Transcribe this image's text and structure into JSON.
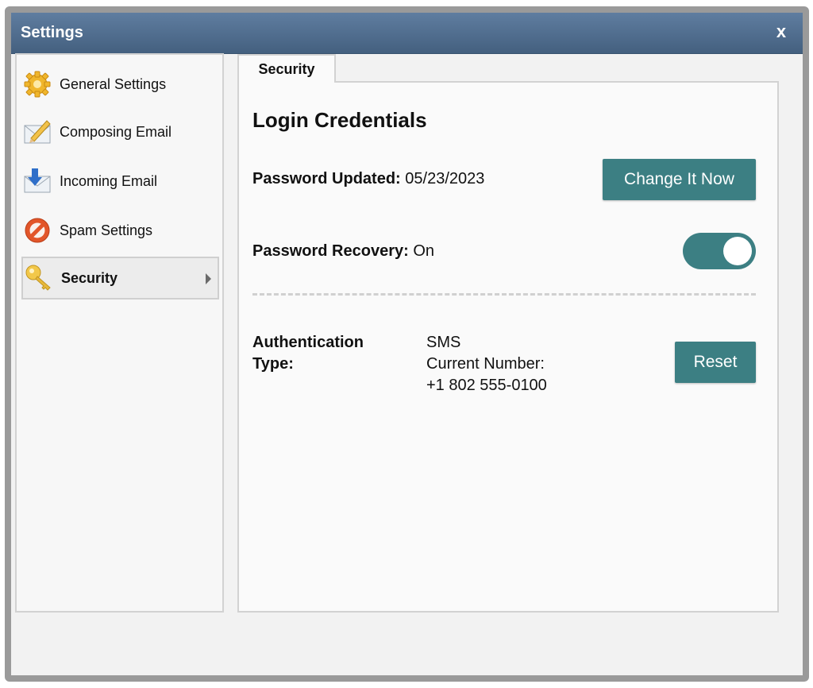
{
  "window": {
    "title": "Settings",
    "close_label": "x"
  },
  "sidebar": {
    "items": [
      {
        "label": "General Settings",
        "icon": "gear-icon"
      },
      {
        "label": "Composing Email",
        "icon": "envelope-pencil-icon"
      },
      {
        "label": "Incoming Email",
        "icon": "envelope-download-icon"
      },
      {
        "label": "Spam Settings",
        "icon": "prohibited-icon"
      },
      {
        "label": "Security",
        "icon": "key-icon",
        "active": true
      }
    ]
  },
  "tabs": [
    {
      "label": "Security",
      "active": true
    }
  ],
  "security": {
    "section_title": "Login Credentials",
    "password_updated": {
      "label": "Password Updated:",
      "value": "05/23/2023",
      "button": "Change It Now"
    },
    "password_recovery": {
      "label": "Password Recovery:",
      "value": "On",
      "toggle_on": true
    },
    "authentication": {
      "label_line1": "Authentication",
      "label_line2": "Type:",
      "type": "SMS",
      "number_label": "Current Number:",
      "number": "+1 802 555-0100",
      "button": "Reset"
    }
  },
  "colors": {
    "titlebar": "#4f6e91",
    "accent": "#3c7f83",
    "border": "#9a9a9a"
  }
}
